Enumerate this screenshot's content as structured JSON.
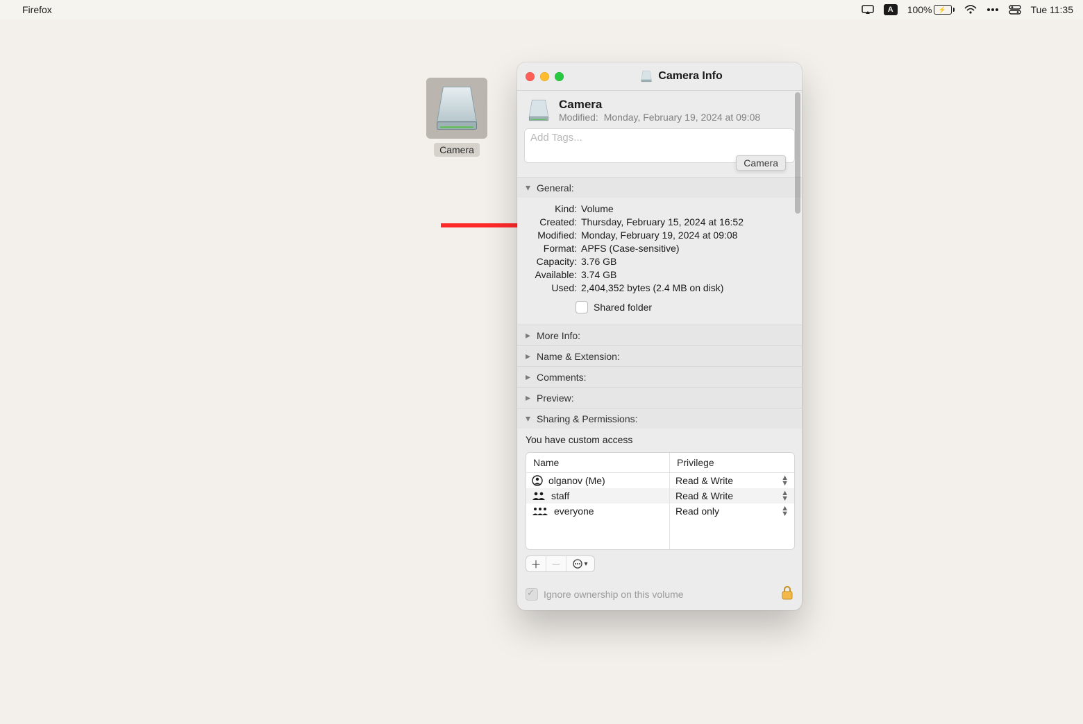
{
  "menubar": {
    "app_name": "Firefox",
    "battery_pct": "100%",
    "clock": "Tue 11:35"
  },
  "desktop": {
    "icon_label": "Camera"
  },
  "window": {
    "title": "Camera Info",
    "traffic_colors": {
      "close": "#ff5f57",
      "min": "#febc2e",
      "max": "#28c840"
    },
    "header": {
      "name": "Camera",
      "modified_label": "Modified:",
      "modified_value": "Monday, February 19, 2024 at 09:08"
    },
    "tags": {
      "placeholder": "Add Tags...",
      "suggestion_chip": "Camera"
    },
    "sections": {
      "general": "General:",
      "more_info": "More Info:",
      "name_ext": "Name & Extension:",
      "comments": "Comments:",
      "preview": "Preview:",
      "sharing": "Sharing & Permissions:"
    },
    "general": {
      "rows": [
        {
          "label": "Kind:",
          "value": "Volume"
        },
        {
          "label": "Created:",
          "value": "Thursday, February 15, 2024 at 16:52"
        },
        {
          "label": "Modified:",
          "value": "Monday, February 19, 2024 at 09:08"
        },
        {
          "label": "Format:",
          "value": "APFS (Case-sensitive)"
        },
        {
          "label": "Capacity:",
          "value": "3.76 GB"
        },
        {
          "label": "Available:",
          "value": "3.74 GB"
        },
        {
          "label": "Used:",
          "value": "2,404,352 bytes (2.4 MB on disk)"
        }
      ],
      "shared_folder_label": "Shared folder",
      "shared_folder_checked": false
    },
    "sharing": {
      "note": "You have custom access",
      "columns": {
        "name": "Name",
        "privilege": "Privilege"
      },
      "rows": [
        {
          "icon": "user",
          "name": "olganov (Me)",
          "privilege": "Read & Write"
        },
        {
          "icon": "group",
          "name": "staff",
          "privilege": "Read & Write"
        },
        {
          "icon": "group",
          "name": "everyone",
          "privilege": "Read only"
        }
      ],
      "ignore_label": "Ignore ownership on this volume",
      "ignore_checked": true
    }
  }
}
